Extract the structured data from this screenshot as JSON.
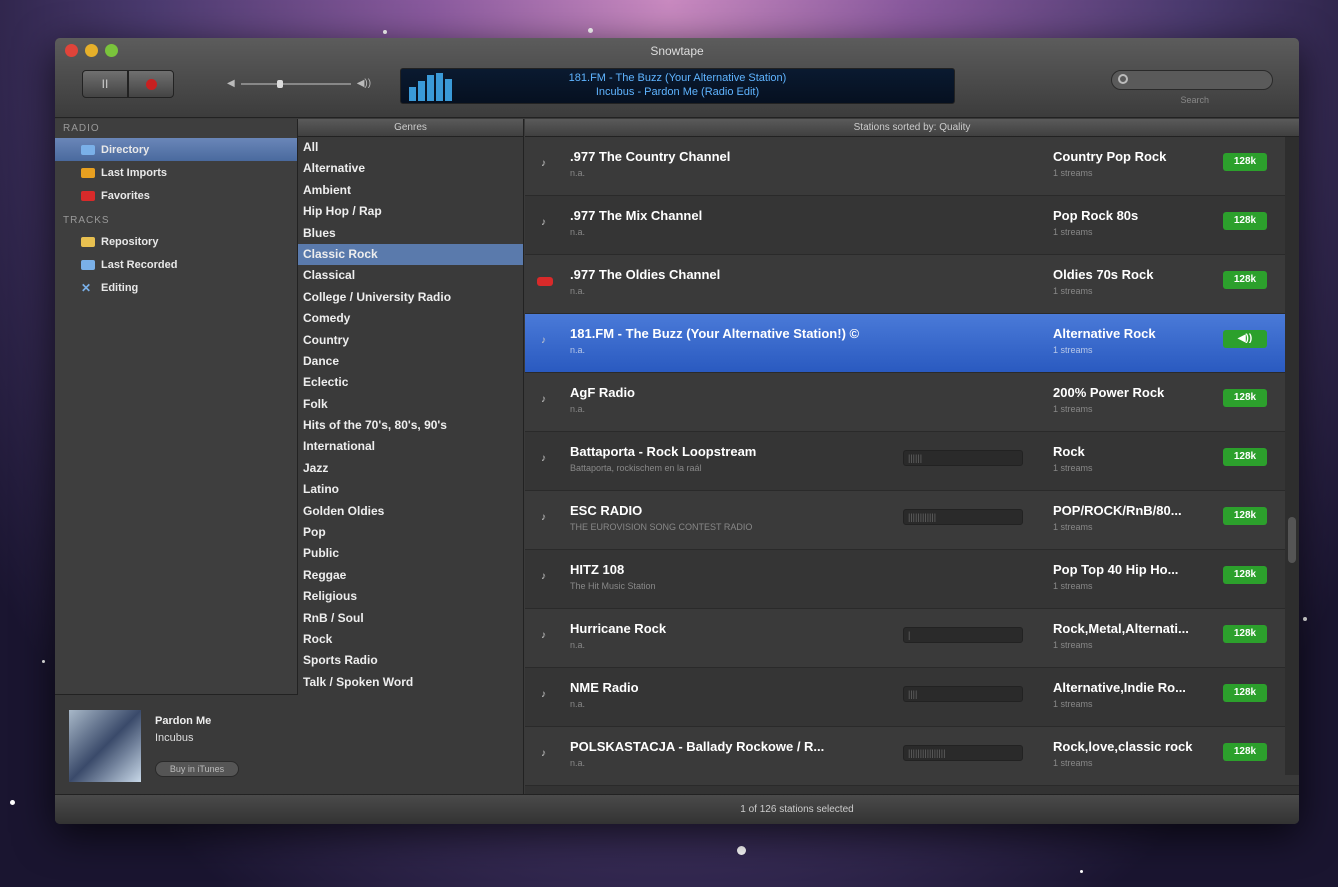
{
  "window": {
    "title": "Snowtape"
  },
  "transport": {
    "pause_label": "II"
  },
  "nowplaying_lcd": {
    "line1": "181.FM - The Buzz (Your Alternative Station)",
    "line2": "Incubus - Pardon Me (Radio Edit)"
  },
  "search": {
    "placeholder": "",
    "label": "Search"
  },
  "sidebar": {
    "radio_header": "RADIO",
    "radio_items": [
      {
        "label": "Directory"
      },
      {
        "label": "Last Imports"
      },
      {
        "label": "Favorites"
      }
    ],
    "tracks_header": "TRACKS",
    "tracks_items": [
      {
        "label": "Repository"
      },
      {
        "label": "Last Recorded"
      },
      {
        "label": "Editing"
      }
    ]
  },
  "track": {
    "title": "Pardon Me",
    "artist": "Incubus",
    "button": "Buy in iTunes"
  },
  "genres": {
    "header": "Genres",
    "items": [
      "All",
      "Alternative",
      "Ambient",
      "Hip Hop / Rap",
      "Blues",
      "Classic Rock",
      "Classical",
      "College / University Radio",
      "Comedy",
      "Country",
      "Dance",
      "Eclectic",
      "Folk",
      "Hits of the 70's, 80's, 90's",
      "International",
      "Jazz",
      "Latino",
      "Golden Oldies",
      "Pop",
      "Public",
      "Reggae",
      "Religious",
      "RnB / Soul",
      "Rock",
      "Sports Radio",
      "Talk / Spoken Word"
    ],
    "selected": 5
  },
  "stations": {
    "header": "Stations sorted by: Quality",
    "rows": [
      {
        "name": ".977 The Country Channel",
        "sub": "n.a.",
        "bar": "",
        "genre": "Country Pop Rock",
        "streams": "1 streams",
        "quality": "128k"
      },
      {
        "name": ".977 The Mix Channel",
        "sub": "n.a.",
        "bar": "",
        "genre": "Pop Rock 80s",
        "streams": "1 streams",
        "quality": "128k"
      },
      {
        "name": ".977 The Oldies Channel",
        "sub": "n.a.",
        "bar": "",
        "genre": "Oldies 70s Rock",
        "streams": "1 streams",
        "quality": "128k"
      },
      {
        "name": "181.FM - The Buzz (Your Alternative Station!) ©",
        "sub": "n.a.",
        "bar": "",
        "genre": "Alternative Rock",
        "streams": "1 streams",
        "quality": "◀))"
      },
      {
        "name": "AgF Radio",
        "sub": "n.a.",
        "bar": "",
        "genre": "200% Power Rock",
        "streams": "1 streams",
        "quality": "128k"
      },
      {
        "name": "Battaporta - Rock Loopstream",
        "sub": "Battaporta, rockischem en la raál",
        "bar": "||||||",
        "genre": "Rock",
        "streams": "1 streams",
        "quality": "128k"
      },
      {
        "name": "ESC RADIO",
        "sub": "THE EUROVISION SONG CONTEST RADIO",
        "bar": "||||||||||||",
        "genre": "POP/ROCK/RnB/80...",
        "streams": "1 streams",
        "quality": "128k"
      },
      {
        "name": "HITZ 108",
        "sub": "The Hit Music Station",
        "bar": "",
        "genre": "Pop Top 40 Hip Ho...",
        "streams": "1 streams",
        "quality": "128k"
      },
      {
        "name": "Hurricane Rock",
        "sub": "n.a.",
        "bar": "|",
        "genre": "Rock,Metal,Alternati...",
        "streams": "1 streams",
        "quality": "128k"
      },
      {
        "name": "NME Radio",
        "sub": "n.a.",
        "bar": "||||",
        "genre": "Alternative,Indie Ro...",
        "streams": "1 streams",
        "quality": "128k"
      },
      {
        "name": "POLSKASTACJA - Ballady Rockowe / R...",
        "sub": "n.a.",
        "bar": "||||||||||||||||",
        "genre": "Rock,love,classic rock",
        "streams": "1 streams",
        "quality": "128k"
      }
    ]
  },
  "status": {
    "text": "1 of 126 stations selected"
  }
}
